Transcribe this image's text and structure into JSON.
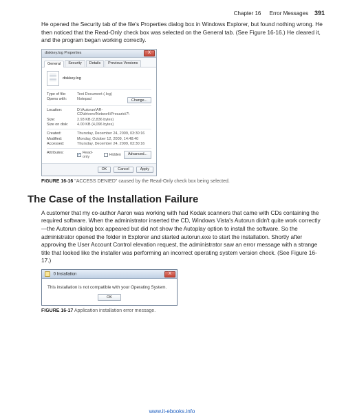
{
  "header": {
    "chapter": "Chapter 16",
    "topic": "Error Messages",
    "page": "391"
  },
  "intro_para": "He opened the Security tab of the file's Properties dialog box in Windows Explorer, but found nothing wrong. He then noticed that the Read-Only check box was selected on the General tab. (See Figure 16-16.) He cleared it, and the program began working correctly.",
  "props": {
    "title": "diskkey.log Properties",
    "close": "X",
    "tabs": {
      "general": "General",
      "security": "Security",
      "details": "Details",
      "previous": "Previous Versions"
    },
    "filename": "diskkey.log",
    "type_k": "Type of file:",
    "type_v": "Text Document (.log)",
    "opens_k": "Opens with:",
    "opens_v": "Notepad",
    "change": "Change...",
    "loc_k": "Location:",
    "loc_v": "D:\\Autorun\\AR-CD\\drivers\\Network\\Presario\\7\\",
    "size_k": "Size:",
    "size_v": "2.93 KB (2,836 bytes)",
    "ondisk_k": "Size on disk:",
    "ondisk_v": "4.00 KB (4,096 bytes)",
    "created_k": "Created:",
    "created_v": "Thursday, December 24, 2009, 03:30:16",
    "modified_k": "Modified:",
    "modified_v": "Monday, October 12, 2009, 14:48:40",
    "accessed_k": "Accessed:",
    "accessed_v": "Thursday, December 24, 2009, 03:30:16",
    "attr_k": "Attributes:",
    "readonly": "Read-only",
    "hidden": "Hidden",
    "advanced": "Advanced...",
    "ok": "OK",
    "cancel": "Cancel",
    "apply": "Apply"
  },
  "caption1_label": "FIGURE 16-16",
  "caption1_text": "\"ACCESS DENIED\" caused by the Read-Only check box being selected.",
  "heading": "The Case of the Installation Failure",
  "main_para": "A customer that my co-author Aaron was working with had Kodak scanners that came with CDs containing the required software. When the administrator inserted the CD, Windows Vista's Autorun didn't quite work correctly—the Autorun dialog box appeared but did not show the Autoplay option to install the software. So the administrator opened the folder in Explorer and started autorun.exe to start the installation. Shortly after approving the User Account Control elevation request, the administrator saw an error message with a strange title that looked like the installer was performing an incorrect operating system version check. (See Figure 16-17.)",
  "install": {
    "title": "0 Installation",
    "close": "X",
    "msg": "This installation is not compatible with your Operating System.",
    "ok": "OK"
  },
  "caption2_label": "FIGURE 16-17",
  "caption2_text": "Application installation error message.",
  "footer_link": "www.it-ebooks.info"
}
